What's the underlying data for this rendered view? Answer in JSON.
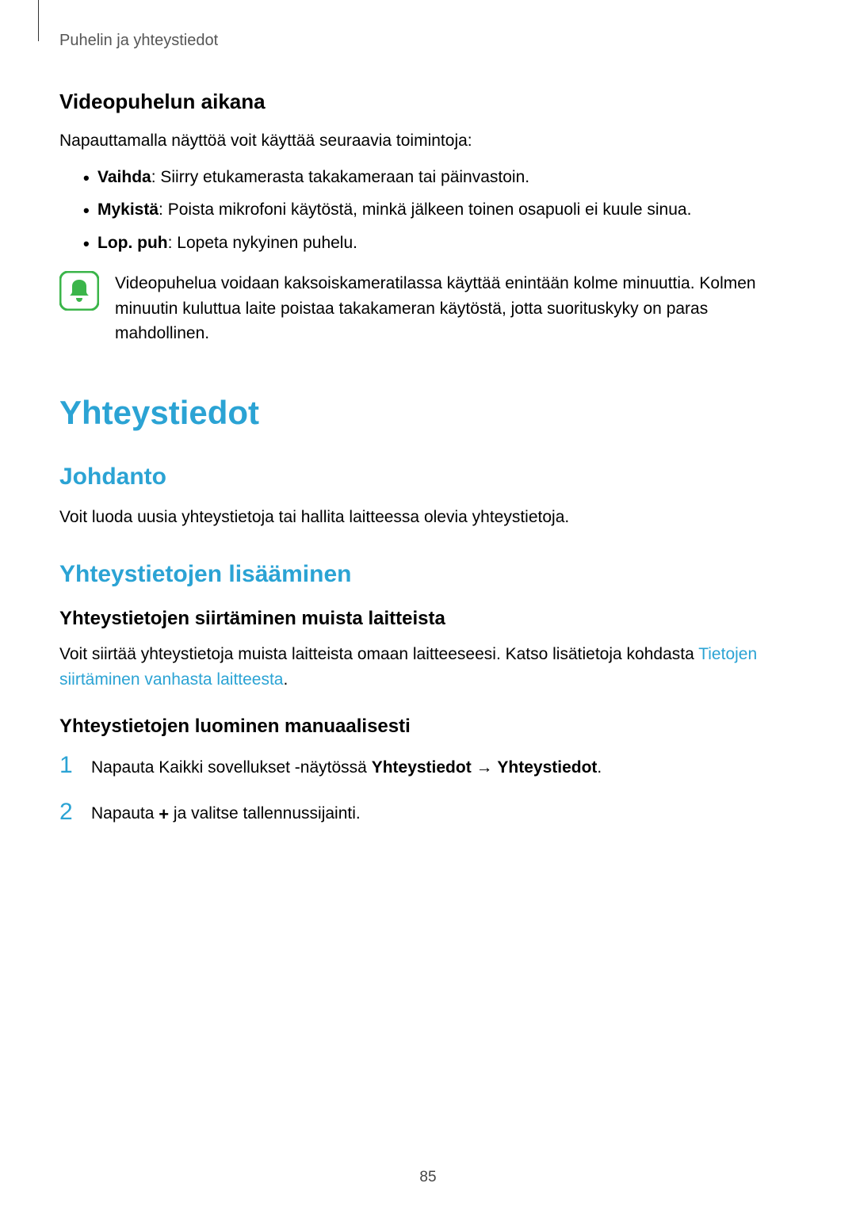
{
  "header": "Puhelin ja yhteystiedot",
  "section1": {
    "heading": "Videopuhelun aikana",
    "intro": "Napauttamalla näyttöä voit käyttää seuraavia toimintoja:",
    "bullets": [
      {
        "bold": "Vaihda",
        "rest": ": Siirry etukamerasta takakameraan tai päinvastoin."
      },
      {
        "bold": "Mykistä",
        "rest": ": Poista mikrofoni käytöstä, minkä jälkeen toinen osapuoli ei kuule sinua."
      },
      {
        "bold": "Lop. puh",
        "rest": ": Lopeta nykyinen puhelu."
      }
    ],
    "infoText": "Videopuhelua voidaan kaksoiskameratilassa käyttää enintään kolme minuuttia. Kolmen minuutin kuluttua laite poistaa takakameran käytöstä, jotta suorituskyky on paras mahdollinen."
  },
  "mainTitle": "Yhteystiedot",
  "section2": {
    "heading": "Johdanto",
    "text": "Voit luoda uusia yhteystietoja tai hallita laitteessa olevia yhteystietoja."
  },
  "section3": {
    "heading": "Yhteystietojen lisääminen",
    "sub1": {
      "heading": "Yhteystietojen siirtäminen muista laitteista",
      "textBefore": "Voit siirtää yhteystietoja muista laitteista omaan laitteeseesi. Katso lisätietoja kohdasta ",
      "link": "Tietojen siirtäminen vanhasta laitteesta",
      "textAfter": "."
    },
    "sub2": {
      "heading": "Yhteystietojen luominen manuaalisesti",
      "steps": [
        {
          "num": "1",
          "before": "Napauta Kaikki sovellukset -näytössä ",
          "bold1": "Yhteystiedot",
          "arrow": " → ",
          "bold2": "Yhteystiedot",
          "after": "."
        },
        {
          "num": "2",
          "before": "Napauta ",
          "plus": "+",
          "after": " ja valitse tallennussijainti."
        }
      ]
    }
  },
  "pageNumber": "85"
}
